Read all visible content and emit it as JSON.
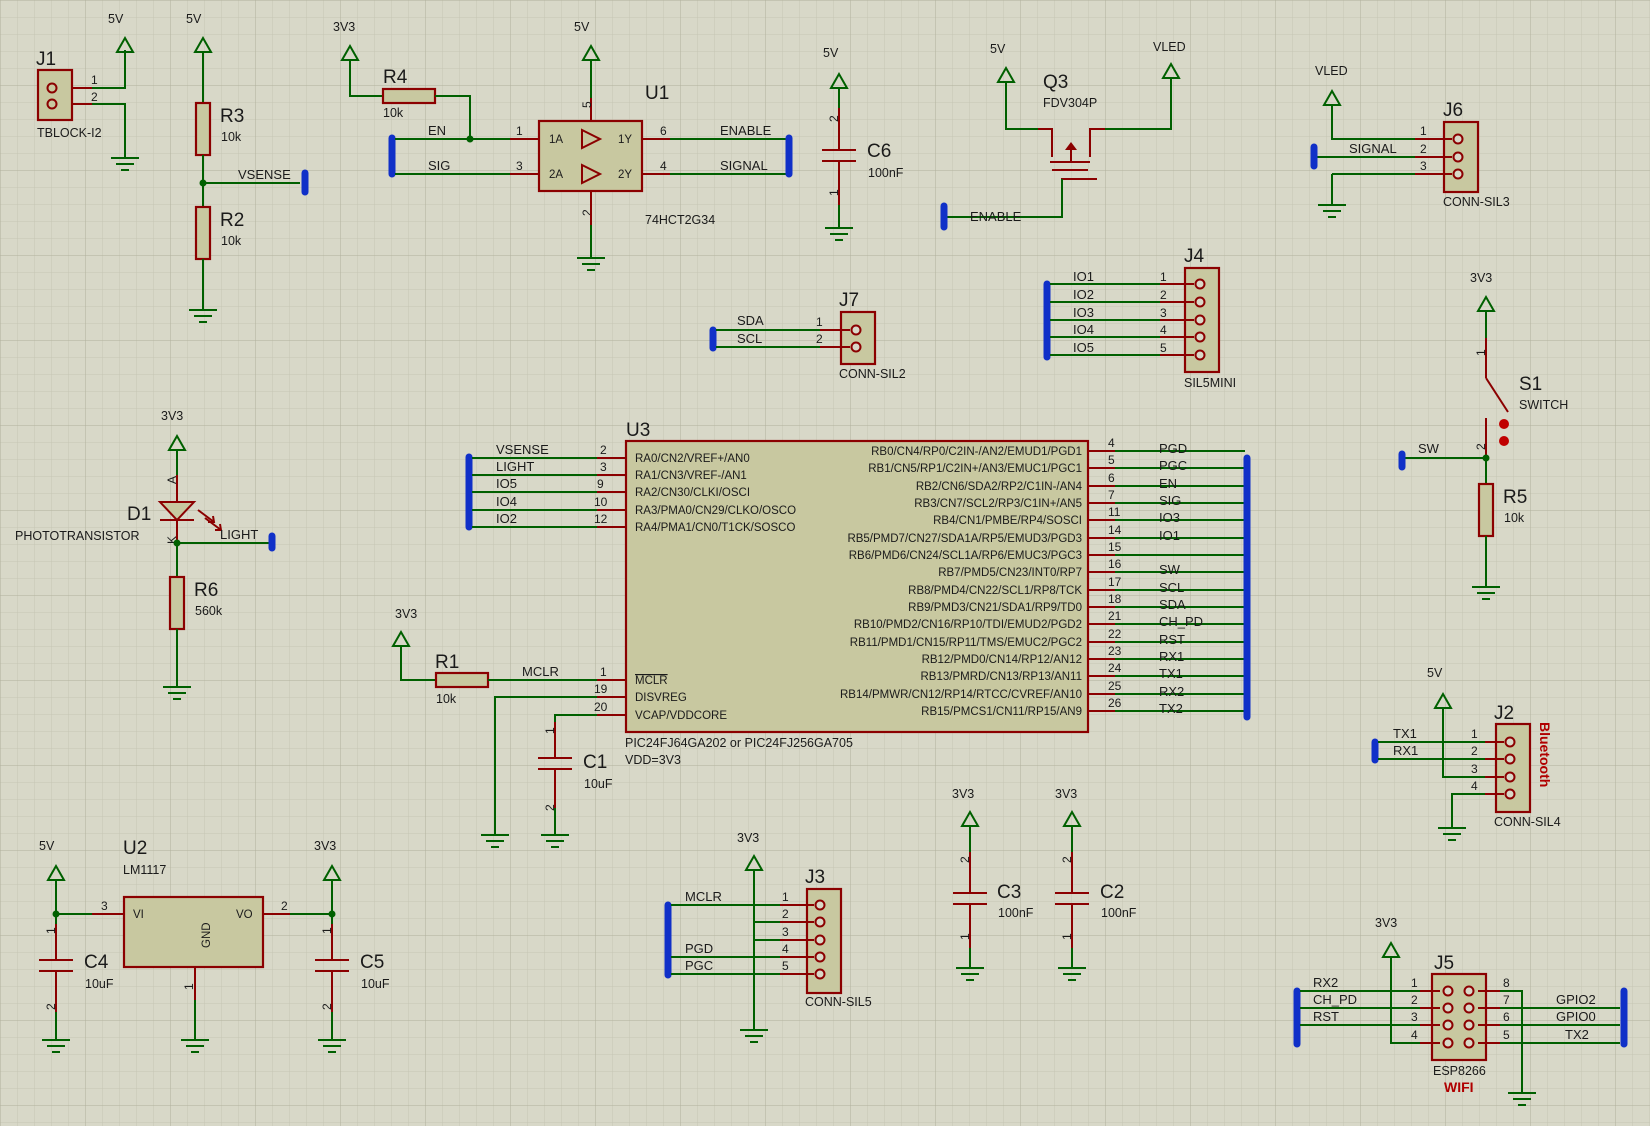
{
  "theme": {
    "background": "#d8d8c8",
    "grid": "#bcbcaa",
    "wire": "#006000",
    "component": "#8b0000",
    "bus": "#1030c8",
    "body_fill": "#c8c8a0"
  },
  "power": {
    "v5": "5V",
    "v33": "3V3",
    "vled": "VLED"
  },
  "components": {
    "j1": {
      "ref": "J1",
      "value": "TBLOCK-I2",
      "pins": [
        "1",
        "2"
      ]
    },
    "r3": {
      "ref": "R3",
      "value": "10k"
    },
    "r2": {
      "ref": "R2",
      "value": "10k"
    },
    "r4": {
      "ref": "R4",
      "value": "10k"
    },
    "u1": {
      "ref": "U1",
      "value": "74HCT2G34",
      "pins": {
        "a1": "1A",
        "a2": "2A",
        "y1": "1Y",
        "y2": "2Y"
      },
      "pin_numbers": [
        "1",
        "3",
        "6",
        "4",
        "5",
        "2"
      ]
    },
    "c6": {
      "ref": "C6",
      "value": "100nF",
      "pins": [
        "2",
        "1"
      ]
    },
    "q3": {
      "ref": "Q3",
      "value": "FDV304P"
    },
    "j6": {
      "ref": "J6",
      "value": "CONN-SIL3",
      "pins": [
        "1",
        "2",
        "3"
      ]
    },
    "j7": {
      "ref": "J7",
      "value": "CONN-SIL2",
      "pins": [
        "1",
        "2"
      ]
    },
    "j4": {
      "ref": "J4",
      "value": "SIL5MINI",
      "pins": [
        "1",
        "2",
        "3",
        "4",
        "5"
      ]
    },
    "s1": {
      "ref": "S1",
      "value": "SWITCH",
      "pins": [
        "1",
        "2"
      ]
    },
    "r5": {
      "ref": "R5",
      "value": "10k"
    },
    "d1": {
      "ref": "D1",
      "value": "PHOTOTRANSISTOR",
      "pins": [
        "A",
        "K"
      ]
    },
    "r6": {
      "ref": "R6",
      "value": "560k"
    },
    "u3": {
      "ref": "U3",
      "value": "PIC24FJ64GA202 or PIC24FJ256GA705",
      "note": "VDD=3V3",
      "left_pins": [
        {
          "num": "2",
          "name": "RA0/CN2/VREF+/AN0",
          "net": "VSENSE"
        },
        {
          "num": "3",
          "name": "RA1/CN3/VREF-/AN1",
          "net": "LIGHT"
        },
        {
          "num": "9",
          "name": "RA2/CN30/CLKI/OSCI",
          "net": "IO5"
        },
        {
          "num": "10",
          "name": "RA3/PMA0/CN29/CLKO/OSCO",
          "net": "IO4"
        },
        {
          "num": "12",
          "name": "RA4/PMA1/CN0/T1CK/SOSCO",
          "net": "IO2"
        }
      ],
      "lower_left_pins": [
        {
          "num": "1",
          "name": "MCLR",
          "net": "MCLR"
        },
        {
          "num": "19",
          "name": "DISVREG",
          "net": ""
        },
        {
          "num": "20",
          "name": "VCAP/VDDCORE",
          "net": ""
        }
      ],
      "right_pins": [
        {
          "num": "4",
          "name": "RB0/CN4/RP0/C2IN-/AN2/EMUD1/PGD1",
          "net": "PGD"
        },
        {
          "num": "5",
          "name": "RB1/CN5/RP1/C2IN+/AN3/EMUC1/PGC1",
          "net": "PGC"
        },
        {
          "num": "6",
          "name": "RB2/CN6/SDA2/RP2/C1IN-/AN4",
          "net": "EN"
        },
        {
          "num": "7",
          "name": "RB3/CN7/SCL2/RP3/C1IN+/AN5",
          "net": "SIG"
        },
        {
          "num": "11",
          "name": "RB4/CN1/PMBE/RP4/SOSCI",
          "net": "IO3"
        },
        {
          "num": "14",
          "name": "RB5/PMD7/CN27/SDA1A/RP5/EMUD3/PGD3",
          "net": "IO1"
        },
        {
          "num": "15",
          "name": "RB6/PMD6/CN24/SCL1A/RP6/EMUC3/PGC3",
          "net": ""
        },
        {
          "num": "16",
          "name": "RB7/PMD5/CN23/INT0/RP7",
          "net": "SW"
        },
        {
          "num": "17",
          "name": "RB8/PMD4/CN22/SCL1/RP8/TCK",
          "net": "SCL"
        },
        {
          "num": "18",
          "name": "RB9/PMD3/CN21/SDA1/RP9/TD0",
          "net": "SDA"
        },
        {
          "num": "21",
          "name": "RB10/PMD2/CN16/RP10/TDI/EMUD2/PGD2",
          "net": "CH_PD"
        },
        {
          "num": "22",
          "name": "RB11/PMD1/CN15/RP11/TMS/EMUC2/PGC2",
          "net": "RST"
        },
        {
          "num": "23",
          "name": "RB12/PMD0/CN14/RP12/AN12",
          "net": "RX1"
        },
        {
          "num": "24",
          "name": "RB13/PMRD/CN13/RP13/AN11",
          "net": "TX1"
        },
        {
          "num": "25",
          "name": "RB14/PMWR/CN12/RP14/RTCC/CVREF/AN10",
          "net": "RX2"
        },
        {
          "num": "26",
          "name": "RB15/PMCS1/CN11/RP15/AN9",
          "net": "TX2"
        }
      ]
    },
    "r1": {
      "ref": "R1",
      "value": "10k"
    },
    "c1": {
      "ref": "C1",
      "value": "10uF",
      "pins": [
        "1",
        "2"
      ]
    },
    "u2": {
      "ref": "U2",
      "value": "LM1117",
      "pins": {
        "vi": "VI",
        "vo": "VO",
        "gnd": "GND"
      },
      "pin_numbers": [
        "3",
        "2",
        "1"
      ]
    },
    "c4": {
      "ref": "C4",
      "value": "10uF",
      "pins": [
        "1",
        "2"
      ]
    },
    "c5": {
      "ref": "C5",
      "value": "10uF",
      "pins": [
        "1",
        "2"
      ]
    },
    "j3": {
      "ref": "J3",
      "value": "CONN-SIL5",
      "pins": [
        "1",
        "2",
        "3",
        "4",
        "5"
      ]
    },
    "c3": {
      "ref": "C3",
      "value": "100nF",
      "pins": [
        "2",
        "1"
      ]
    },
    "c2": {
      "ref": "C2",
      "value": "100nF",
      "pins": [
        "2",
        "1"
      ]
    },
    "j2": {
      "ref": "J2",
      "value": "CONN-SIL4",
      "label": "Bluetooth",
      "pins": [
        "1",
        "2",
        "3",
        "4"
      ]
    },
    "j5": {
      "ref": "J5",
      "value": "ESP8266",
      "label": "WIFI",
      "pins_left": [
        "1",
        "2",
        "3",
        "4"
      ],
      "pins_right": [
        "8",
        "7",
        "6",
        "5"
      ]
    }
  },
  "nets": {
    "vsense": "VSENSE",
    "en": "EN",
    "sig": "SIG",
    "enable": "ENABLE",
    "signal": "SIGNAL",
    "sda": "SDA",
    "scl": "SCL",
    "io1": "IO1",
    "io2": "IO2",
    "io3": "IO3",
    "io4": "IO4",
    "io5": "IO5",
    "sw": "SW",
    "light": "LIGHT",
    "mclr": "MCLR",
    "pgd": "PGD",
    "pgc": "PGC",
    "tx1": "TX1",
    "rx1": "RX1",
    "rx2": "RX2",
    "ch_pd": "CH_PD",
    "rst": "RST",
    "gpio2": "GPIO2",
    "gpio0": "GPIO0",
    "tx2": "TX2"
  }
}
